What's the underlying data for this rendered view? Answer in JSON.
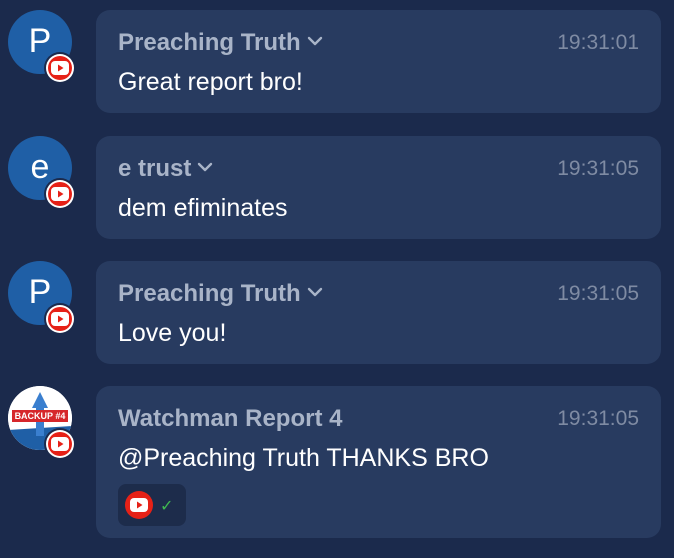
{
  "messages": [
    {
      "avatar_letter": "P",
      "author": "Preaching Truth",
      "time": "19:31:01",
      "text": "Great report bro!",
      "has_menu": true
    },
    {
      "avatar_letter": "e",
      "author": "e trust",
      "time": "19:31:05",
      "text": "dem efiminates",
      "has_menu": true
    },
    {
      "avatar_letter": "P",
      "author": "Preaching Truth",
      "time": "19:31:05",
      "text": "Love you!",
      "has_menu": true
    },
    {
      "avatar_label": "BACKUP #4",
      "author": "Watchman Report 4",
      "time": "19:31:05",
      "text": "@Preaching Truth THANKS BRO",
      "has_menu": false,
      "source_chip": true
    }
  ],
  "icons": {
    "platform_badge": "youtube-icon",
    "menu": "chevron-down-icon",
    "sent": "check-icon"
  },
  "colors": {
    "background": "#1b2a4c",
    "bubble": "#283b60",
    "avatar": "#1f5fa6",
    "youtube_red": "#e62117",
    "check_green": "#3fb950"
  }
}
